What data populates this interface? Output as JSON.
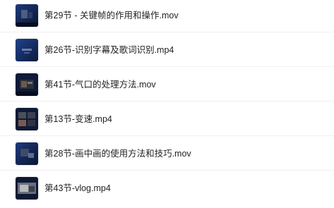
{
  "files": [
    {
      "name": "第29节 - 关键帧的作用和操作.mov",
      "thumb_icon": "video-thumbnail-icon"
    },
    {
      "name": "第26节-识别字幕及歌词识别.mp4",
      "thumb_icon": "video-thumbnail-icon"
    },
    {
      "name": "第41节-气口的处理方法.mov",
      "thumb_icon": "video-thumbnail-icon"
    },
    {
      "name": "第13节-变速.mp4",
      "thumb_icon": "video-thumbnail-icon"
    },
    {
      "name": "第28节-画中画的使用方法和技巧.mov",
      "thumb_icon": "video-thumbnail-icon"
    },
    {
      "name": "第43节-vlog.mp4",
      "thumb_icon": "video-thumbnail-icon"
    }
  ],
  "colors": {
    "text": "#222222",
    "thumb_dark": "#0b1a3c",
    "thumb_light": "#1d3a7a",
    "divider": "#f0f0f0"
  }
}
